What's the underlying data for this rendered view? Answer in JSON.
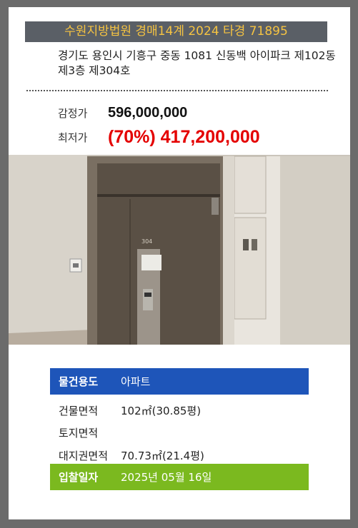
{
  "case": {
    "title": "수원지방법원 경매14계 2024 타경 71895"
  },
  "address": "경기도 용인시 기흥구 중동 1081 신동백 아이파크 제102동 제3층 제304호",
  "prices": {
    "appraisal_label": "감정가",
    "appraisal_value": "596,000,000",
    "minimum_label": "최저가",
    "minimum_value": "(70%) 417,200,000"
  },
  "photo": {
    "unit_number": "304"
  },
  "details": {
    "usage_label": "물건용도",
    "usage_value": "아파트",
    "building_area_label": "건물면적",
    "building_area_value": "102㎡(30.85평)",
    "land_area_label": "토지면적",
    "land_area_value": "",
    "land_right_label": "대지권면적",
    "land_right_value": "70.73㎡(21.4평)",
    "bid_date_label": "입찰일자",
    "bid_date_value": "2025년 05월 16일"
  },
  "colors": {
    "header_bg": "#5a5f66",
    "header_text": "#f5c342",
    "minimum_price": "#e40000",
    "usage_row": "#1e55b9",
    "date_row": "#7bb91f"
  }
}
